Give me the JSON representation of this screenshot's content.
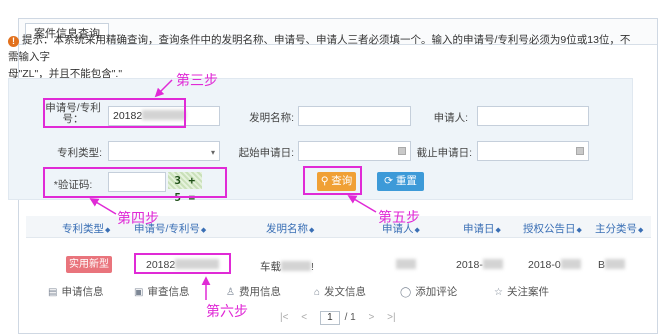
{
  "tab": {
    "label": "案件信息查询"
  },
  "tip": {
    "icon": "warning-icon",
    "line1": "提示：本系统采用精确查询，查询条件中的发明名称、申请号、申请人三者必须填一个。输入的申请号/专利号必须为9位或13位，不需输入字",
    "line2": "母\"ZL\"，并且不能包含\".\""
  },
  "form": {
    "app_no_label": "申请号/专利号：",
    "app_no_value": "20182",
    "invention_name_label": "发明名称:",
    "applicant_label": "申请人:",
    "patent_type_label": "专利类型:",
    "start_date_label": "起始申请日:",
    "end_date_label": "截止申请日:",
    "captcha_label": "*验证码:",
    "captcha_text": "3 + 5 ="
  },
  "buttons": {
    "query": "查询",
    "reset": "重置"
  },
  "table": {
    "headers": [
      "专利类型",
      "申请号/专利号",
      "发明名称",
      "申请人",
      "申请日",
      "授权公告日",
      "主分类号"
    ],
    "row": {
      "type_badge": "实用新型",
      "app_no": "20182",
      "name": "车载",
      "name_tail": "!",
      "app_date": "2018-",
      "grant_date": "2018-0",
      "class_no": "B"
    }
  },
  "actions": [
    {
      "icon": "info-icon",
      "label": "申请信息"
    },
    {
      "icon": "image-icon",
      "label": "审查信息"
    },
    {
      "icon": "fee-icon",
      "label": "费用信息"
    },
    {
      "icon": "document-icon",
      "label": "发文信息"
    },
    {
      "icon": "comment-icon",
      "label": "添加评论"
    },
    {
      "icon": "star-icon",
      "label": "关注案件"
    }
  ],
  "pager": {
    "first": "|<",
    "prev": "<",
    "current": "1",
    "total": "/ 1",
    "next": ">",
    "last": ">|"
  },
  "annotations": {
    "step3": "第三步",
    "step4": "第四步",
    "step5": "第五步",
    "step6": "第六步",
    "color": "#e02ad6"
  }
}
